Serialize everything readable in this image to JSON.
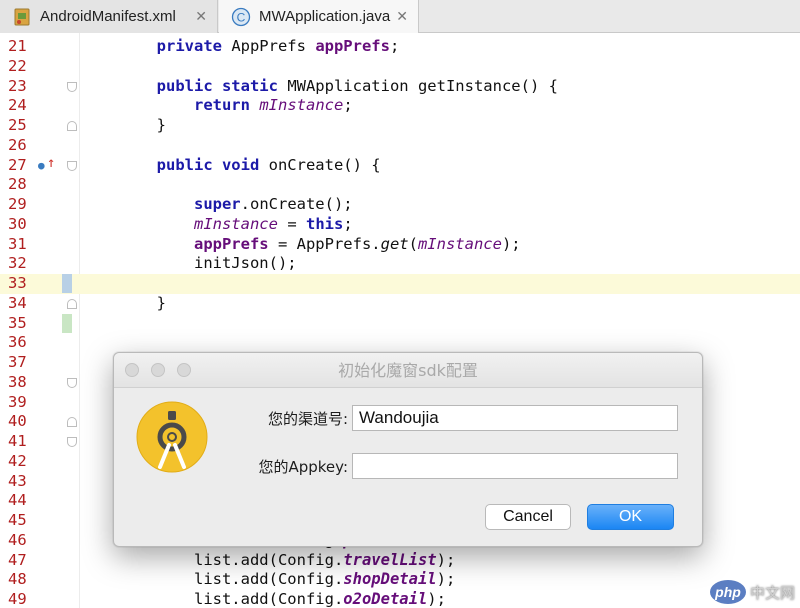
{
  "tabs": [
    {
      "label": "AndroidManifest.xml",
      "close": "✕",
      "icon": "xml-file-icon"
    },
    {
      "label": "MWApplication.java",
      "close": "✕",
      "icon": "java-class-icon",
      "icon_letter": "C"
    }
  ],
  "editor": {
    "lines": [
      {
        "num": "21",
        "segs": [
          [
            "t",
            "        "
          ],
          [
            "kw",
            "private"
          ],
          [
            "t",
            " AppPrefs "
          ],
          [
            "field",
            "appPrefs"
          ],
          [
            "t",
            ";"
          ]
        ]
      },
      {
        "num": "22",
        "segs": []
      },
      {
        "num": "23",
        "segs": [
          [
            "t",
            "        "
          ],
          [
            "kw",
            "public static"
          ],
          [
            "t",
            " MWApplication getInstance() {"
          ]
        ],
        "fold": "down"
      },
      {
        "num": "24",
        "segs": [
          [
            "t",
            "            "
          ],
          [
            "kw",
            "return"
          ],
          [
            "t",
            " "
          ],
          [
            "sfield",
            "mInstance"
          ],
          [
            "t",
            ";"
          ]
        ]
      },
      {
        "num": "25",
        "segs": [
          [
            "t",
            "        }"
          ]
        ],
        "fold": "up"
      },
      {
        "num": "26",
        "segs": []
      },
      {
        "num": "27",
        "segs": [
          [
            "t",
            "        "
          ],
          [
            "kw",
            "public void"
          ],
          [
            "t",
            " onCreate() {"
          ]
        ],
        "fold": "down",
        "override": true
      },
      {
        "num": "28",
        "segs": []
      },
      {
        "num": "29",
        "segs": [
          [
            "t",
            "            "
          ],
          [
            "kw",
            "super"
          ],
          [
            "t",
            ".onCreate();"
          ]
        ]
      },
      {
        "num": "30",
        "segs": [
          [
            "t",
            "            "
          ],
          [
            "sfield",
            "mInstance"
          ],
          [
            "t",
            " = "
          ],
          [
            "kw",
            "this"
          ],
          [
            "t",
            ";"
          ]
        ]
      },
      {
        "num": "31",
        "segs": [
          [
            "t",
            "            "
          ],
          [
            "field",
            "appPrefs"
          ],
          [
            "t",
            " = AppPrefs."
          ],
          [
            "smethod",
            "get"
          ],
          [
            "t",
            "("
          ],
          [
            "sfield",
            "mInstance"
          ],
          [
            "t",
            ");"
          ]
        ]
      },
      {
        "num": "32",
        "segs": [
          [
            "t",
            "            initJson();"
          ]
        ]
      },
      {
        "num": "33",
        "segs": [],
        "current": true,
        "change": "#b8d0e6"
      },
      {
        "num": "34",
        "segs": [
          [
            "t",
            "        }"
          ]
        ],
        "fold": "up"
      },
      {
        "num": "35",
        "segs": [],
        "change": "#c9e6c4"
      },
      {
        "num": "36",
        "segs": []
      },
      {
        "num": "37",
        "segs": []
      },
      {
        "num": "38",
        "segs": [],
        "fold": "down"
      },
      {
        "num": "39",
        "segs": []
      },
      {
        "num": "40",
        "segs": [],
        "fold": "up"
      },
      {
        "num": "41",
        "segs": [],
        "fold": "down"
      },
      {
        "num": "42",
        "segs": []
      },
      {
        "num": "43",
        "segs": []
      },
      {
        "num": "44",
        "segs": []
      },
      {
        "num": "45",
        "segs": []
      },
      {
        "num": "46",
        "segs": [
          [
            "t",
            "            list.add(Config."
          ],
          [
            "sfieldb",
            "placeList"
          ],
          [
            "t",
            ");"
          ]
        ]
      },
      {
        "num": "47",
        "segs": [
          [
            "t",
            "            list.add(Config."
          ],
          [
            "sfieldb",
            "travelList"
          ],
          [
            "t",
            ");"
          ]
        ]
      },
      {
        "num": "48",
        "segs": [
          [
            "t",
            "            list.add(Config."
          ],
          [
            "sfieldb",
            "shopDetail"
          ],
          [
            "t",
            ");"
          ]
        ]
      },
      {
        "num": "49",
        "segs": [
          [
            "t",
            "            list.add(Config."
          ],
          [
            "sfieldb",
            "o2oDetail"
          ],
          [
            "t",
            ");"
          ]
        ]
      }
    ]
  },
  "dialog": {
    "title": "初始化魔窗sdk配置",
    "channel_label": "您的渠道号:",
    "channel_value": "Wandoujia",
    "appkey_label": "您的Appkey:",
    "appkey_value": "",
    "cancel_label": "Cancel",
    "ok_label": "OK",
    "logo_icon": "android-studio-logo-icon"
  },
  "watermark": {
    "badge": "php",
    "text": "中文网"
  },
  "colors": {
    "keyword": "#1c1aa8",
    "field": "#660e7a",
    "line_number": "#b01e1e",
    "ok_button": "#1b86f3"
  }
}
